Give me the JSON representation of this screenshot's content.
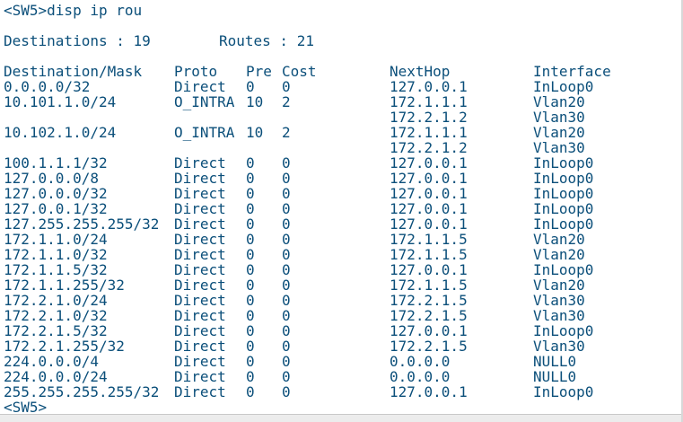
{
  "command_line": "<SW5>disp ip rou",
  "summary": {
    "destinations": "Destinations : 19",
    "routes": "Routes : 21"
  },
  "headers": {
    "dest": "Destination/Mask",
    "proto": "Proto",
    "pre": "Pre",
    "cost": "Cost",
    "nexthop": "NextHop",
    "iface": "Interface"
  },
  "rows": [
    {
      "dest": "0.0.0.0/32",
      "proto": "Direct",
      "pre": "0",
      "cost": "0",
      "nexthop": "127.0.0.1",
      "iface": "InLoop0"
    },
    {
      "dest": "10.101.1.0/24",
      "proto": "O_INTRA",
      "pre": "10",
      "cost": "2",
      "nexthop": "172.1.1.1",
      "iface": "Vlan20"
    },
    {
      "dest": "",
      "proto": "",
      "pre": "",
      "cost": "",
      "nexthop": "172.2.1.2",
      "iface": "Vlan30"
    },
    {
      "dest": "10.102.1.0/24",
      "proto": "O_INTRA",
      "pre": "10",
      "cost": "2",
      "nexthop": "172.1.1.1",
      "iface": "Vlan20"
    },
    {
      "dest": "",
      "proto": "",
      "pre": "",
      "cost": "",
      "nexthop": "172.2.1.2",
      "iface": "Vlan30"
    },
    {
      "dest": "100.1.1.1/32",
      "proto": "Direct",
      "pre": "0",
      "cost": "0",
      "nexthop": "127.0.0.1",
      "iface": "InLoop0"
    },
    {
      "dest": "127.0.0.0/8",
      "proto": "Direct",
      "pre": "0",
      "cost": "0",
      "nexthop": "127.0.0.1",
      "iface": "InLoop0"
    },
    {
      "dest": "127.0.0.0/32",
      "proto": "Direct",
      "pre": "0",
      "cost": "0",
      "nexthop": "127.0.0.1",
      "iface": "InLoop0"
    },
    {
      "dest": "127.0.0.1/32",
      "proto": "Direct",
      "pre": "0",
      "cost": "0",
      "nexthop": "127.0.0.1",
      "iface": "InLoop0"
    },
    {
      "dest": "127.255.255.255/32",
      "proto": "Direct",
      "pre": "0",
      "cost": "0",
      "nexthop": "127.0.0.1",
      "iface": "InLoop0"
    },
    {
      "dest": "172.1.1.0/24",
      "proto": "Direct",
      "pre": "0",
      "cost": "0",
      "nexthop": "172.1.1.5",
      "iface": "Vlan20"
    },
    {
      "dest": "172.1.1.0/32",
      "proto": "Direct",
      "pre": "0",
      "cost": "0",
      "nexthop": "172.1.1.5",
      "iface": "Vlan20"
    },
    {
      "dest": "172.1.1.5/32",
      "proto": "Direct",
      "pre": "0",
      "cost": "0",
      "nexthop": "127.0.0.1",
      "iface": "InLoop0"
    },
    {
      "dest": "172.1.1.255/32",
      "proto": "Direct",
      "pre": "0",
      "cost": "0",
      "nexthop": "172.1.1.5",
      "iface": "Vlan20"
    },
    {
      "dest": "172.2.1.0/24",
      "proto": "Direct",
      "pre": "0",
      "cost": "0",
      "nexthop": "172.2.1.5",
      "iface": "Vlan30"
    },
    {
      "dest": "172.2.1.0/32",
      "proto": "Direct",
      "pre": "0",
      "cost": "0",
      "nexthop": "172.2.1.5",
      "iface": "Vlan30"
    },
    {
      "dest": "172.2.1.5/32",
      "proto": "Direct",
      "pre": "0",
      "cost": "0",
      "nexthop": "127.0.0.1",
      "iface": "InLoop0"
    },
    {
      "dest": "172.2.1.255/32",
      "proto": "Direct",
      "pre": "0",
      "cost": "0",
      "nexthop": "172.2.1.5",
      "iface": "Vlan30"
    },
    {
      "dest": "224.0.0.0/4",
      "proto": "Direct",
      "pre": "0",
      "cost": "0",
      "nexthop": "0.0.0.0",
      "iface": "NULL0"
    },
    {
      "dest": "224.0.0.0/24",
      "proto": "Direct",
      "pre": "0",
      "cost": "0",
      "nexthop": "0.0.0.0",
      "iface": "NULL0"
    },
    {
      "dest": "255.255.255.255/32",
      "proto": "Direct",
      "pre": "0",
      "cost": "0",
      "nexthop": "127.0.0.1",
      "iface": "InLoop0"
    }
  ],
  "prompt_line": "<SW5>",
  "colors": {
    "text": "#0b4f7a",
    "background": "#ffffff"
  }
}
